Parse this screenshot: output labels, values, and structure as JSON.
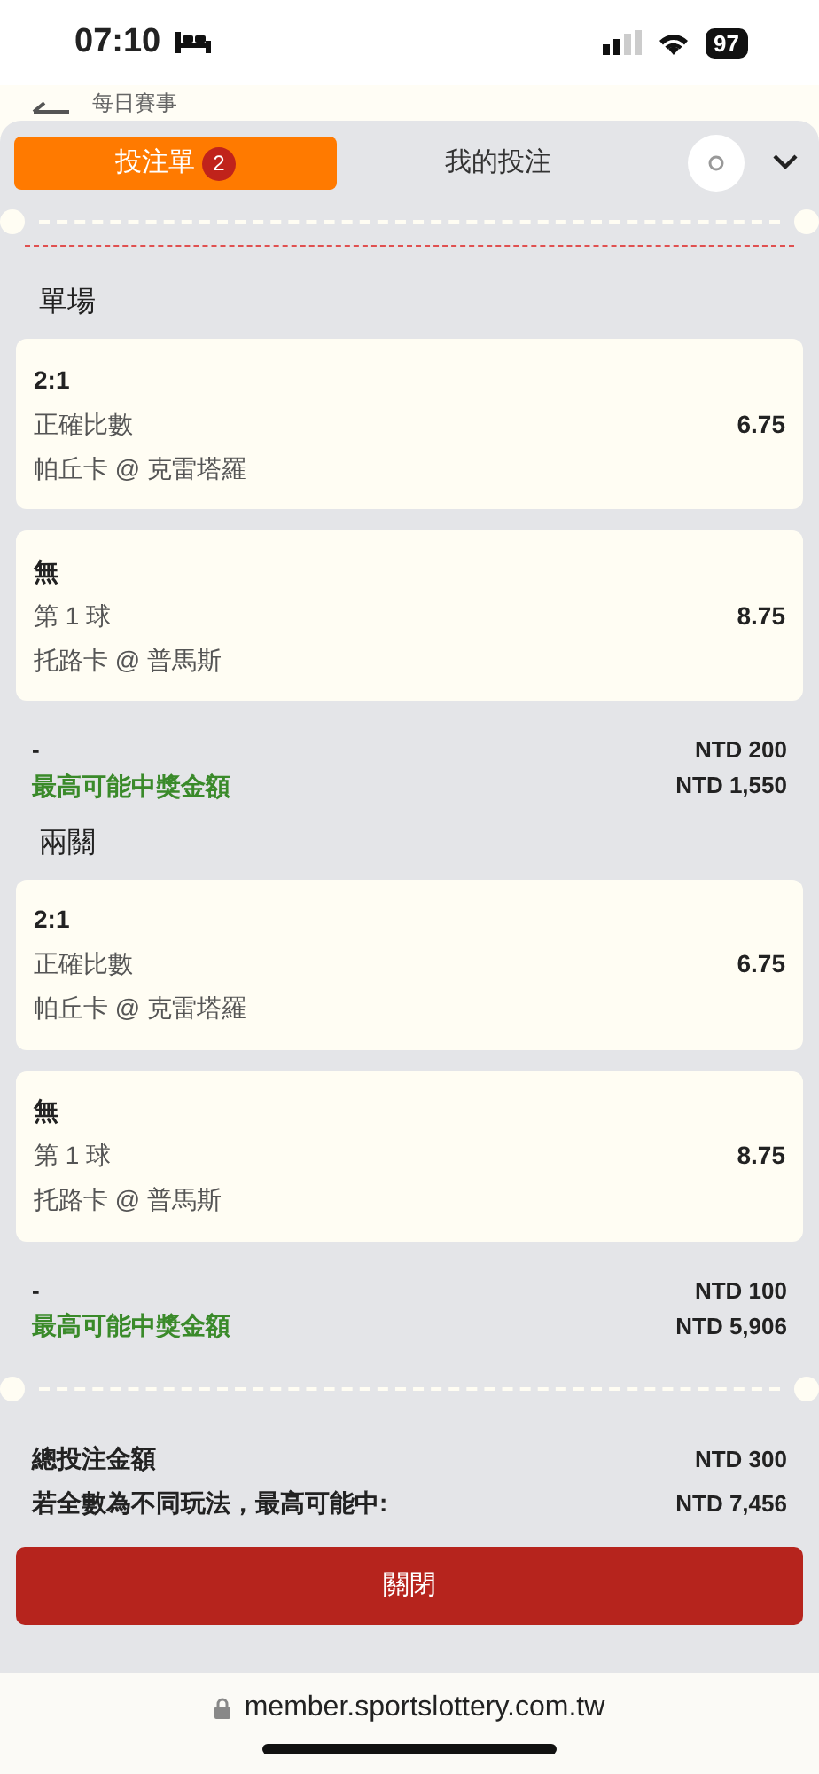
{
  "status_bar": {
    "time": "07:10",
    "battery": "97"
  },
  "background_page": {
    "title": "每日賽事"
  },
  "tabs": [
    {
      "label": "投注單",
      "badge": "2",
      "selected": true
    },
    {
      "label": "我的投注",
      "selected": false
    }
  ],
  "sections": [
    {
      "title": "單場",
      "bets": [
        {
          "selection": "2:1",
          "market": "正確比數",
          "match": "帕丘卡 @ 克雷塔羅",
          "odds": "6.75"
        },
        {
          "selection": "無",
          "market": "第 1 球",
          "match": "托路卡 @ 普馬斯",
          "odds": "8.75"
        }
      ],
      "stake_label": "-",
      "stake": "NTD 200",
      "payout_label": "最高可能中獎金額",
      "payout": "NTD 1,550"
    },
    {
      "title": "兩關",
      "bets": [
        {
          "selection": "2:1",
          "market": "正確比數",
          "match": "帕丘卡 @ 克雷塔羅",
          "odds": "6.75"
        },
        {
          "selection": "無",
          "market": "第 1 球",
          "match": "托路卡 @ 普馬斯",
          "odds": "8.75"
        }
      ],
      "stake_label": "-",
      "stake": "NTD 100",
      "payout_label": "最高可能中獎金額",
      "payout": "NTD 5,906"
    }
  ],
  "totals": [
    {
      "label": "總投注金額",
      "value": "NTD 300"
    },
    {
      "label": "若全數為不同玩法，最高可能中:",
      "value": "NTD 7,456"
    }
  ],
  "close_button": "關閉",
  "url": "member.sportslottery.com.tw"
}
